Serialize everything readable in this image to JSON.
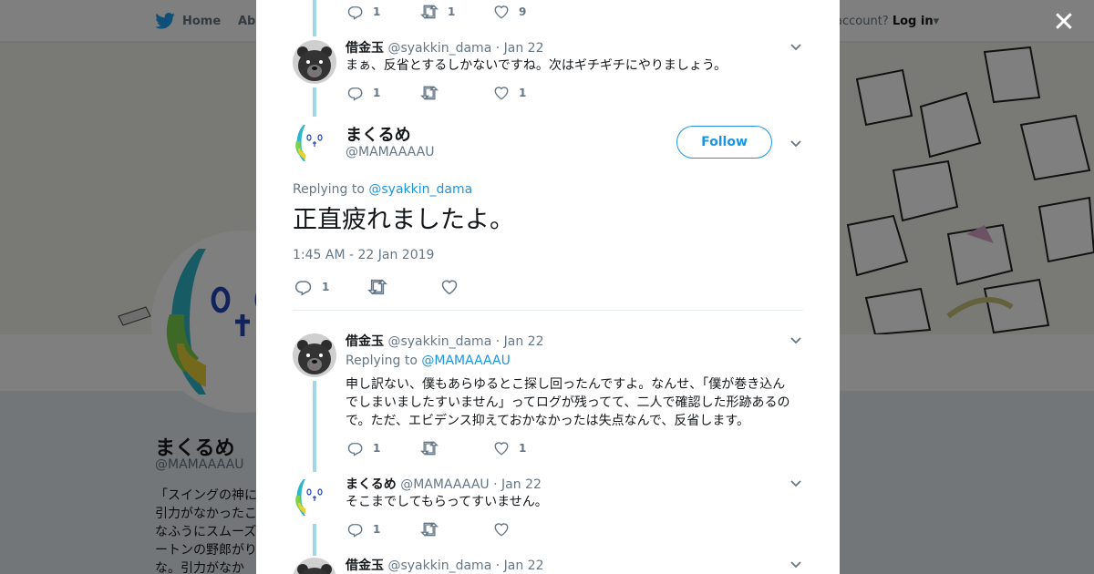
{
  "topnav": {
    "home_label": "Home",
    "about_label": "Abo",
    "account_prompt": "account?",
    "login_label": "Log in"
  },
  "profile": {
    "name": "まくるめ",
    "handle": "@MAMAAAAU",
    "bio_lines": [
      "「スイングの神に",
      "引力がなかったこ",
      "なふうにスムーズ",
      "ートンの野郎がり",
      "な。引力がなか"
    ]
  },
  "colors": {
    "accent": "#1b95e0",
    "thread_line": "#a0d9e3",
    "text_secondary": "#657786"
  },
  "thread": [
    {
      "actions": {
        "reply": "1",
        "retweet": "1",
        "like": "9"
      }
    },
    {
      "name": "借金玉",
      "handle": "@syakkin_dama",
      "date": "· Jan 22",
      "text": "まぁ、反省とするしかないですね。次はギチギチにやりましょう。",
      "actions": {
        "reply": "1",
        "retweet": "",
        "like": "1"
      }
    }
  ],
  "main_tweet": {
    "name": "まくるめ",
    "handle": "@MAMAAAAU",
    "follow_label": "Follow",
    "replying_prefix": "Replying to ",
    "replying_handle": "@syakkin_dama",
    "text": "正直疲れましたよ。",
    "timestamp": "1:45 AM - 22 Jan 2019",
    "actions": {
      "reply": "1",
      "retweet": "",
      "like": ""
    }
  },
  "replies": [
    {
      "name": "借金玉",
      "handle": "@syakkin_dama",
      "date": "· Jan 22",
      "replying_prefix": "Replying to ",
      "replying_handle": "@MAMAAAAU",
      "text_lines": [
        "申し訳ない、僕もあらゆるとこ探し回ったんですよ。なんせ、「僕が巻き込ん",
        "でしまいましたすいません」ってログが残ってて、二人で確認した形跡あるの",
        "で。ただ、エビデンス抑えておかなかったは失点なんで、反省します。"
      ],
      "actions": {
        "reply": "1",
        "retweet": "",
        "like": "1"
      }
    },
    {
      "name": "まくるめ",
      "handle": "@MAMAAAAU",
      "date": "· Jan 22",
      "text": "そこまでしてもらってすいません。",
      "actions": {
        "reply": "1",
        "retweet": "",
        "like": ""
      }
    },
    {
      "name": "借金玉",
      "handle": "@syakkin_dama",
      "date": "· Jan 22"
    }
  ],
  "icons": {
    "close": "close-icon",
    "bird": "twitter-bird-icon",
    "reply": "reply-icon",
    "retweet": "retweet-icon",
    "like": "heart-icon",
    "caret": "chevron-down-icon"
  }
}
